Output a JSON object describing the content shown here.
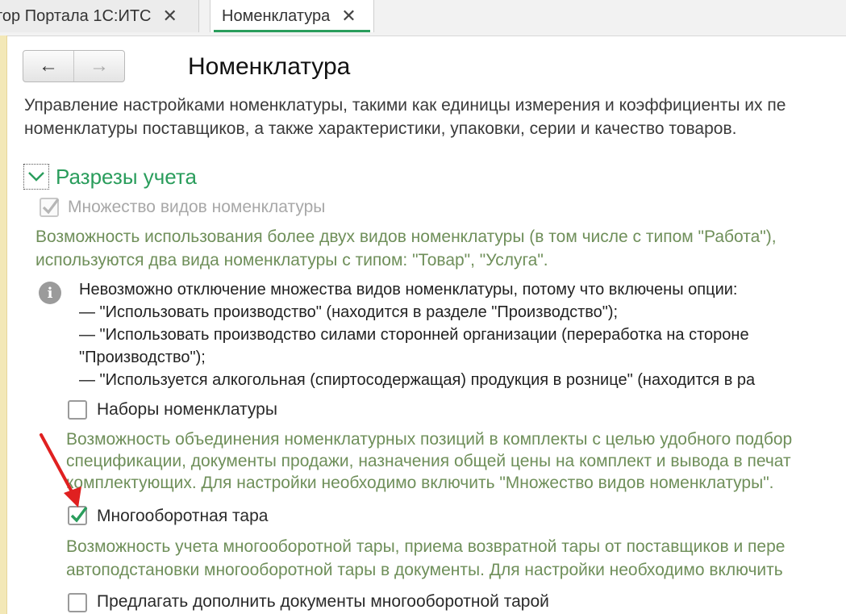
{
  "tabs": [
    {
      "label": "тор Портала 1С:ИТС",
      "close": "✕"
    },
    {
      "label": "Номенклатура",
      "close": "✕"
    }
  ],
  "nav": {
    "back_icon": "←",
    "forward_icon": "→"
  },
  "page_title": "Номенклатура",
  "description": [
    "Управление настройками номенклатуры, такими как единицы измерения и коэффициенты их пе",
    "номенклатуры поставщиков, а также характеристики, упаковки, серии и качество товаров."
  ],
  "section": {
    "title": "Разрезы учета",
    "expanded": true
  },
  "options": {
    "multi_kinds": {
      "label": "Множество видов номенклатуры",
      "checked": true,
      "disabled": true,
      "hint": [
        "Возможность использования более двух видов номенклатуры (в том числе с типом \"Работа\"),",
        "используются два вида номенклатуры с типом: \"Товар\", \"Услуга\"."
      ]
    },
    "info": [
      "Невозможно отключение множества видов номенклатуры, потому что включены опции:",
      "— \"Использовать производство\" (находится в разделе \"Производство\");",
      "— \"Использовать производство силами сторонней организации (переработка на стороне",
      "\"Производство\");",
      "— \"Используется алкогольная (спиртосодержащая) продукция в рознице\" (находится в ра"
    ],
    "kits": {
      "label": "Наборы номенклатуры",
      "checked": false,
      "hint": [
        "Возможность объединения номенклатурных позиций в комплекты с целью удобного подбор",
        "спецификации, документы продажи, назначения общей цены на комплект и вывода в печат",
        "комплектующих. Для настройки необходимо включить \"Множество видов номенклатуры\"."
      ]
    },
    "returnable_tare": {
      "label": "Многооборотная тара",
      "checked": true,
      "hint": [
        "Возможность учета многооборотной тары, приема возвратной тары от поставщиков и пере",
        "автоподстановки многооборотной тары в документы. Для настройки необходимо включить"
      ]
    },
    "suggest_tare": {
      "label": "Предлагать дополнить документы многооборотной тарой",
      "checked": false
    }
  },
  "colors": {
    "accent_green": "#2a9d5c",
    "hint_green": "#6f8f5a",
    "annotation_red": "#e02020"
  }
}
